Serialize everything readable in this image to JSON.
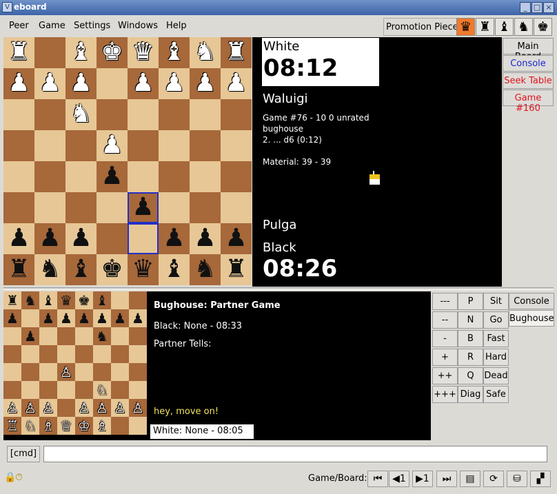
{
  "window": {
    "title": "eboard",
    "app_icon": "V"
  },
  "menu": [
    "Peer",
    "Game",
    "Settings",
    "Windows",
    "Help"
  ],
  "promotion": {
    "label": "Promotion Piece",
    "pieces": [
      "♛",
      "♜",
      "♝",
      "♞",
      "♚"
    ],
    "selected": 0
  },
  "main_board": [
    [
      "♜",
      "",
      "♝",
      "♚",
      "♛",
      "♝",
      "♞",
      "♜"
    ],
    [
      "♟",
      "♟",
      "♟",
      "",
      "♟",
      "♟",
      "♟",
      "♟"
    ],
    [
      "",
      "",
      "♞",
      "",
      "",
      "",
      "",
      ""
    ],
    [
      "",
      "",
      "",
      "♟",
      "",
      "",
      "",
      ""
    ],
    [
      "",
      "",
      "",
      "♟",
      "",
      "",
      "",
      ""
    ],
    [
      "",
      "",
      "",
      "",
      "♟",
      "",
      "",
      ""
    ],
    [
      "♟",
      "♟",
      "♟",
      "",
      "",
      "♟",
      "♟",
      "♟"
    ],
    [
      "♜",
      "♞",
      "♝",
      "♚",
      "♛",
      "♝",
      "♞",
      "♜"
    ]
  ],
  "main_board_colors": [
    "wwwwwwww",
    "wwwwwwww",
    "..w.....",
    "...w....",
    "...b....",
    "....b...",
    "bbb..bbb",
    "bbbbbbbb"
  ],
  "info": {
    "white_label": "White",
    "white_clock": "08:12",
    "white_player": "Waluigi",
    "game_line1": "Game #76 - 10 0 unrated",
    "game_line2": "bughouse",
    "move": "2. ... d6 (0:12)",
    "material": "Material: 39 - 39",
    "black_player": "Pulga",
    "black_label": "Black",
    "black_clock": "08:26"
  },
  "right_tabs": [
    "Main Board",
    "Console",
    "Seek Table",
    "Game #160"
  ],
  "partner": {
    "title": "Bughouse: Partner Game",
    "black": "Black: None - 08:33",
    "tells_label": "Partner Tells:",
    "tell": "hey, move on!",
    "white": "White: None - 08:05"
  },
  "mini_board": [
    [
      "♜",
      "♞",
      "♝",
      "♛",
      "♚",
      "♝",
      "",
      ""
    ],
    [
      "♟",
      "",
      "♟",
      "♟",
      "♟",
      "♟",
      "♟",
      "♟"
    ],
    [
      "",
      "♟",
      "",
      "",
      "",
      "♞",
      "",
      ""
    ],
    [
      "",
      "",
      "",
      "",
      "",
      "",
      "",
      ""
    ],
    [
      "",
      "",
      "",
      "♙",
      "",
      "",
      "",
      ""
    ],
    [
      "",
      "",
      "",
      "",
      "",
      "♘",
      "",
      ""
    ],
    [
      "♙",
      "♙",
      "♙",
      "",
      "♙",
      "♙",
      "♙",
      "♙"
    ],
    [
      "♖",
      "♘",
      "♗",
      "♕",
      "♔",
      "♗",
      "",
      ""
    ]
  ],
  "mini_board_colors": [
    "bbbbbb..",
    "b.bbbbbb",
    ".b...b..",
    "........",
    "...w....",
    ".....w..",
    "www.wwww",
    "wwwwww.."
  ],
  "keys": {
    "col1": [
      "---",
      "--",
      "-",
      "+",
      "++",
      "+++"
    ],
    "col2": [
      "P",
      "N",
      "B",
      "R",
      "Q",
      "Diag"
    ],
    "col3": [
      "Sit",
      "Go",
      "Fast",
      "Hard",
      "Dead",
      "Safe"
    ]
  },
  "lower_tabs": [
    "Console",
    "Bughouse"
  ],
  "cmd": {
    "label": "[cmd]",
    "value": ""
  },
  "status": {
    "game_board_label": "Game/Board:",
    "nav": [
      "⏮",
      "◀1",
      "▶1",
      "⏭"
    ],
    "tools": [
      "▤",
      "⟳",
      "⛁",
      "▞"
    ]
  },
  "colors": {
    "accent": "#f07a2c",
    "console_tab": "#1a28d0",
    "seek_tab": "#e0141e",
    "highlight": "#2230c8"
  }
}
